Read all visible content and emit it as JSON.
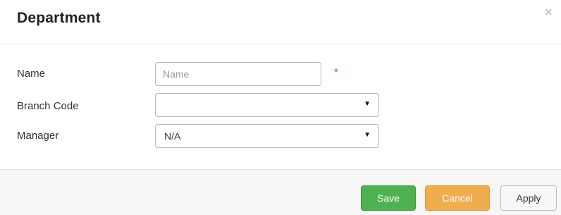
{
  "dialog": {
    "title": "Department",
    "close_glyph": "×"
  },
  "form": {
    "name": {
      "label": "Name",
      "placeholder": "Name",
      "value": "",
      "required_marker": "*"
    },
    "branch_code": {
      "label": "Branch Code",
      "selected": ""
    },
    "manager": {
      "label": "Manager",
      "selected": "N/A"
    },
    "dropdown_glyph": "▼"
  },
  "footer": {
    "save_label": "Save",
    "cancel_label": "Cancel",
    "apply_label": "Apply"
  },
  "colors": {
    "save": "#4fb250",
    "cancel": "#f0ad4e",
    "required": "#e03b3b"
  }
}
